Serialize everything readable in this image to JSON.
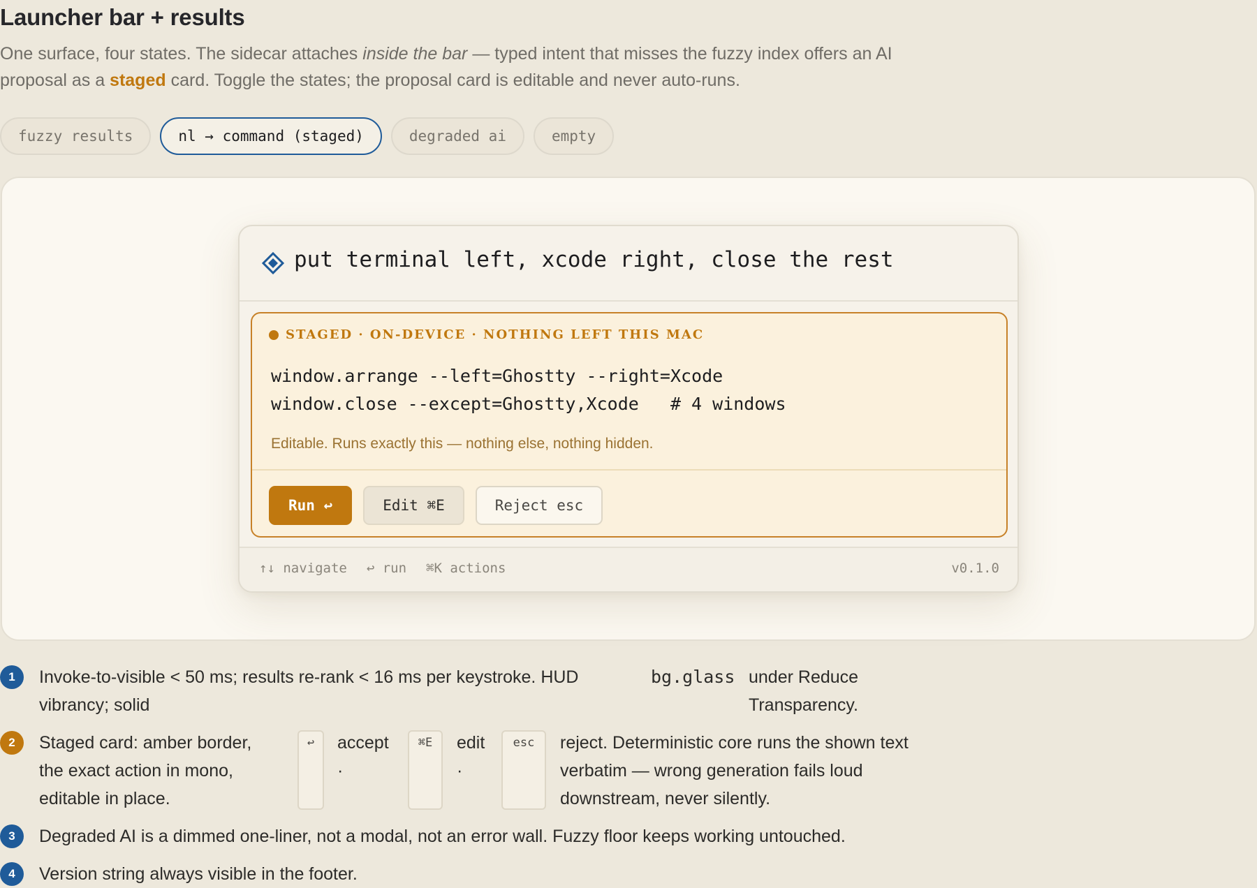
{
  "page": {
    "title": "Launcher bar + results",
    "intro": {
      "part1": "One surface, four states. The sidecar attaches ",
      "emphasis": "inside the bar",
      "part2": " — typed intent that misses the fuzzy index offers an AI proposal as a ",
      "accent": "staged",
      "part3": " card. Toggle the states; the proposal card is editable and never auto-runs."
    }
  },
  "tabs": [
    {
      "label": "fuzzy results",
      "active": false
    },
    {
      "label": "nl → command (staged)",
      "active": true
    },
    {
      "label": "degraded ai",
      "active": false
    },
    {
      "label": "empty",
      "active": false
    }
  ],
  "launcher": {
    "query_icon": "diamond-icon",
    "query": "put terminal left, xcode right, close the rest",
    "card": {
      "badge": "STAGED · ON-DEVICE · NOTHING LEFT THIS MAC",
      "code_line1": "window.arrange --left=Ghostty --right=Xcode",
      "code_line2": "window.close --except=Ghostty,Xcode   # 4 windows",
      "note": "Editable. Runs exactly this — nothing else, nothing hidden.",
      "run_label": "Run ↩",
      "edit_label": "Edit ⌘E",
      "reject_label": "Reject esc"
    },
    "footer": {
      "hint_navigate": "↑↓ navigate",
      "hint_run": "↩ run",
      "hint_actions": "⌘K actions",
      "version": "v0.1.0"
    }
  },
  "notes": {
    "n1": {
      "num": "1",
      "text_a": "Invoke-to-visible < 50 ms; results re-rank < 16 ms per keystroke. HUD vibrancy; solid",
      "code": "bg.glass",
      "text_b": "under Reduce Transparency."
    },
    "n2": {
      "num": "2",
      "text_a": "Staged card: amber border, the exact action in mono, editable in place.",
      "kbd1": "↩",
      "word1": "accept",
      "kbd2": "⌘E",
      "word2": "edit",
      "kbd3": "esc",
      "text_b": "reject. Deterministic core runs the shown text verbatim — wrong generation fails loud downstream, never silently.",
      "dot": "·"
    },
    "n3": {
      "num": "3",
      "text": "Degraded AI is a dimmed one-liner, not a modal, not an error wall. Fuzzy floor keeps working untouched."
    },
    "n4": {
      "num": "4",
      "text": "Version string always visible in the footer."
    }
  },
  "colors": {
    "accent_amber": "#c0780f",
    "accent_blue": "#1f5b99",
    "background": "#ede8dc"
  }
}
